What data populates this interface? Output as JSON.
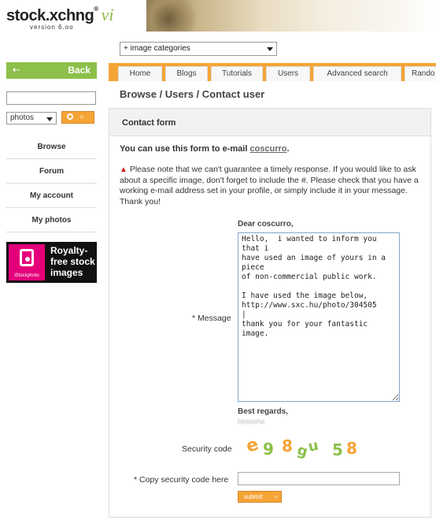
{
  "header": {
    "logo_text": "stock.xchng",
    "logo_reg": "®",
    "logo_vi": "vi",
    "version": "version 6.oo"
  },
  "category_select": {
    "value": "+ image categories"
  },
  "sidebar": {
    "back_label": "Back",
    "search_value": "",
    "search_type": "photos",
    "nav": [
      {
        "label": "Browse"
      },
      {
        "label": "Forum"
      },
      {
        "label": "My account"
      },
      {
        "label": "My photos"
      }
    ],
    "ad": {
      "brand": "iStockphoto",
      "line1": "Royalty-",
      "line2": "free stock",
      "line3": "images"
    }
  },
  "tabs": [
    "Home",
    "Blogs",
    "Tutorials",
    "Users",
    "Advanced search",
    "Rando"
  ],
  "breadcrumb": "Browse / Users / Contact user",
  "panel": {
    "title": "Contact form",
    "intro_prefix": "You can use this form to e-mail ",
    "intro_user": "coscurro",
    "intro_suffix": ".",
    "warning": "Please note that we can't guarantee a timely response. If you would like to ask about a specific image, don't forget to include the #. Please check that you have a working e-mail address set in your profile, or simply include it in your message. Thank you!"
  },
  "form": {
    "dear": "Dear coscurro,",
    "message_label": "* Message",
    "message_value": "Hello,  i wanted to inform you that i\nhave used an image of yours in a piece\nof non-commercial public work.\n\nI have used the image below,\nhttp://www.sxc.hu/photo/304505\n|\nthank you for your fantastic image.",
    "regards": "Best regards,",
    "sender": "hbsoohe",
    "security_label": "Security code",
    "captcha_chars": [
      "e",
      "9",
      "8",
      "g",
      "u",
      "5",
      "8"
    ],
    "copy_label": "* Copy security code here",
    "copy_value": "",
    "submit_label": "submit"
  },
  "colors": {
    "accent_orange": "#f5a436",
    "accent_green": "#8cc04a",
    "istock_pink": "#e4007a"
  }
}
